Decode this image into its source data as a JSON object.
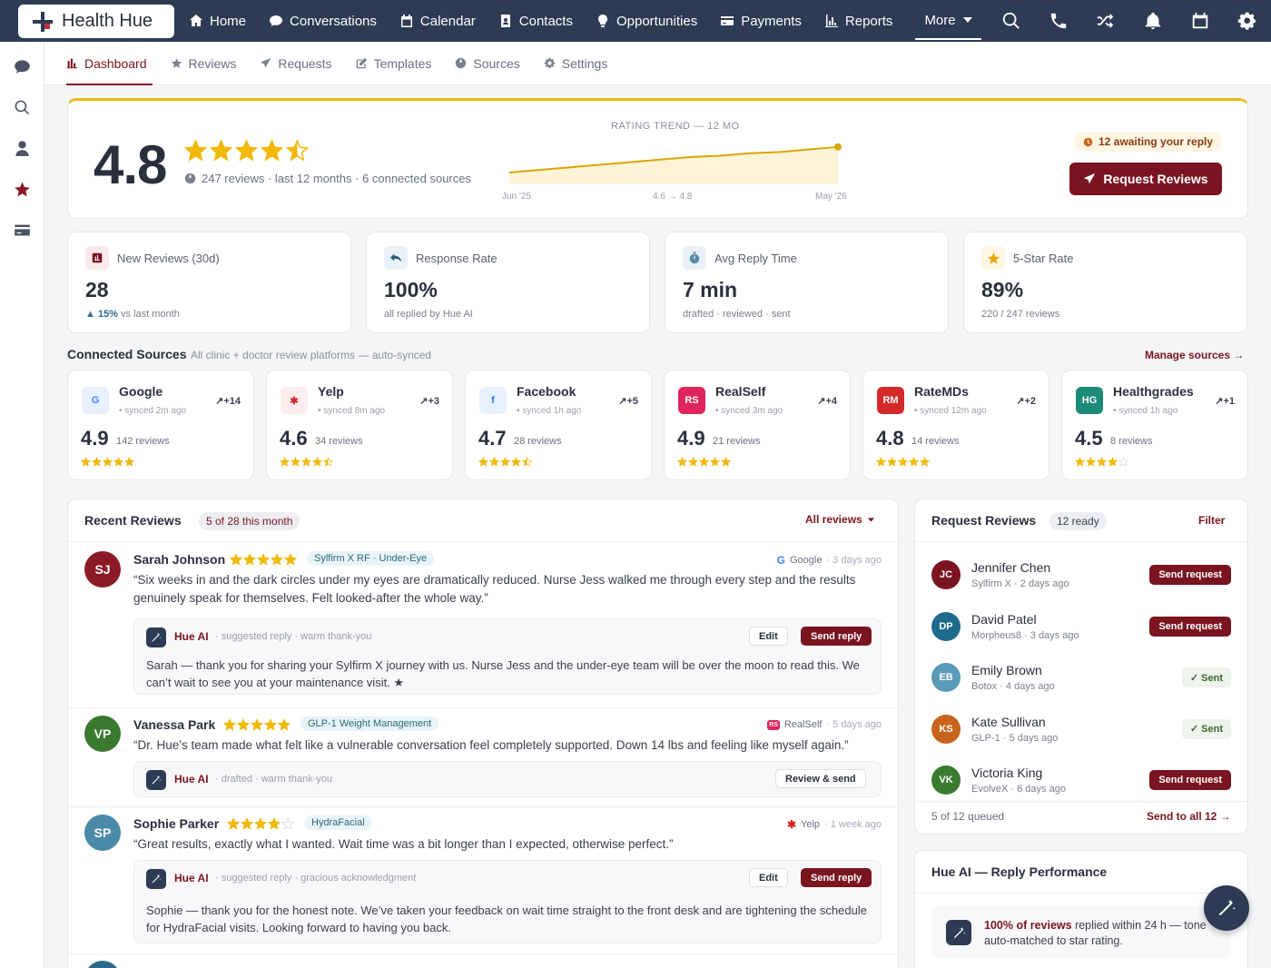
{
  "app": {
    "logo_text": "Health Hue"
  },
  "nav": {
    "items": [
      {
        "label": "Home",
        "icon": "home-icon"
      },
      {
        "label": "Conversations",
        "icon": "chat-icon"
      },
      {
        "label": "Calendar",
        "icon": "calendar-icon"
      },
      {
        "label": "Contacts",
        "icon": "contacts-icon"
      },
      {
        "label": "Opportunities",
        "icon": "lightbulb-icon"
      },
      {
        "label": "Payments",
        "icon": "card-icon"
      },
      {
        "label": "Reports",
        "icon": "chart-icon"
      }
    ],
    "more": "More"
  },
  "subnav": {
    "tabs": [
      {
        "label": "Dashboard",
        "active": true
      },
      {
        "label": "Reviews"
      },
      {
        "label": "Requests"
      },
      {
        "label": "Templates"
      },
      {
        "label": "Sources"
      },
      {
        "label": "Settings"
      }
    ]
  },
  "hero": {
    "rating": "4.8",
    "stars": 4.5,
    "subtitle": "247 reviews · last 12 months · 6 connected sources",
    "trend_title": "RATING TREND — 12 MO",
    "trend_start": "Jun '25",
    "trend_mid": "4.6 → 4.8",
    "trend_end": "May '26",
    "trend_values": [
      4.6,
      4.62,
      4.64,
      4.66,
      4.68,
      4.7,
      4.72,
      4.73,
      4.75,
      4.76,
      4.78,
      4.8
    ],
    "awaiting": "12 awaiting your reply",
    "request_button": "Request Reviews"
  },
  "stats": [
    {
      "label": "New Reviews (30d)",
      "value": "28",
      "sub_highlight": "▲ 15%",
      "sub": " vs last month"
    },
    {
      "label": "Response Rate",
      "value": "100%",
      "sub": "all replied by Hue AI"
    },
    {
      "label": "Avg Reply Time",
      "value": "7 min",
      "sub": "drafted · reviewed · sent"
    },
    {
      "label": "5-Star Rate",
      "value": "89%",
      "sub": "220 / 247 reviews"
    }
  ],
  "sources": {
    "title": "Connected Sources",
    "desc": "All clinic + doctor review platforms — auto-synced",
    "manage": "Manage sources →",
    "items": [
      {
        "name": "Google",
        "badge": "G",
        "color": "#e8f0fe",
        "badge_text": "#4285f4",
        "sync": "synced 2m ago",
        "delta": "+14",
        "rating": "4.9",
        "count": "142 reviews",
        "stars": 5
      },
      {
        "name": "Yelp",
        "badge": "✱",
        "color": "#fdecee",
        "badge_text": "#d32323",
        "sync": "synced 8m ago",
        "delta": "+3",
        "rating": "4.6",
        "count": "34 reviews",
        "stars": 4.5
      },
      {
        "name": "Facebook",
        "badge": "f",
        "color": "#e7f0fd",
        "badge_text": "#1877f2",
        "sync": "synced 1h ago",
        "delta": "+5",
        "rating": "4.7",
        "count": "28 reviews",
        "stars": 4.5
      },
      {
        "name": "RealSelf",
        "badge": "RS",
        "color": "#e0245e",
        "badge_text": "#ffffff",
        "sync": "synced 3m ago",
        "delta": "+4",
        "rating": "4.9",
        "count": "21 reviews",
        "stars": 5
      },
      {
        "name": "RateMDs",
        "badge": "RM",
        "color": "#d42a2a",
        "badge_text": "#ffffff",
        "sync": "synced 12m ago",
        "delta": "+2",
        "rating": "4.8",
        "count": "14 reviews",
        "stars": 5
      },
      {
        "name": "Healthgrades",
        "badge": "HG",
        "color": "#1d8a7a",
        "badge_text": "#ffffff",
        "sync": "synced 1h ago",
        "delta": "+1",
        "rating": "4.5",
        "count": "8 reviews",
        "stars": 4
      }
    ]
  },
  "recent": {
    "title": "Recent Reviews",
    "pill": "5 of 28 this month",
    "filter": "All reviews",
    "reviews": [
      {
        "initials": "SJ",
        "avatar_color": "#8b1a24",
        "name": "Sarah Johnson",
        "stars": 5,
        "tag": "Sylfirm X RF · Under-Eye",
        "source": "Google",
        "when": "· 3 days ago",
        "text": "“Six weeks in and the dark circles under my eyes are dramatically reduced. Nurse Jess walked me through every step and the results genuinely speak for themselves. Felt looked-after the whole way.”",
        "ai_label": "Hue AI",
        "ai_meta": "· suggested reply · warm thank-you",
        "edit": "Edit",
        "send": "Send reply",
        "reply": "Sarah — thank you for sharing your Sylfirm X journey with us. Nurse Jess and the under-eye team will be over the moon to read this. We can’t wait to see you at your maintenance visit. ★"
      },
      {
        "initials": "VP",
        "avatar_color": "#3a7a2e",
        "name": "Vanessa Park",
        "stars": 5,
        "tag": "GLP-1 Weight Management",
        "source": "RealSelf",
        "when": "· 5 days ago",
        "text": "“Dr. Hue’s team made what felt like a vulnerable conversation feel completely supported. Down 14 lbs and feeling like myself again.”",
        "ai_label": "Hue AI",
        "ai_meta": "· drafted · warm thank-you",
        "review_send": "Review & send"
      },
      {
        "initials": "SP",
        "avatar_color": "#4a8aa8",
        "name": "Sophie Parker",
        "stars": 4,
        "tag": "HydraFacial",
        "source": "Yelp",
        "when": "· 1 week ago",
        "text": "“Great results, exactly what I wanted. Wait time was a bit longer than I expected, otherwise perfect.”",
        "ai_label": "Hue AI",
        "ai_meta": "· suggested reply · gracious acknowledgment",
        "edit": "Edit",
        "send": "Send reply",
        "reply": "Sophie — thank you for the honest note. We’ve taken your feedback on wait time straight to the front desk and are tightening the schedule for HydraFacial visits. Looking forward to having you back."
      }
    ]
  },
  "requests": {
    "title": "Request Reviews",
    "pill": "12 ready",
    "filter": "Filter",
    "rows": [
      {
        "initials": "JC",
        "color": "#7a1420",
        "name": "Jennifer Chen",
        "sub": "Sylfirm X · 2 days ago",
        "action": "Send request",
        "sent": false
      },
      {
        "initials": "DP",
        "color": "#1d6a8a",
        "name": "David Patel",
        "sub": "Morpheus8 · 3 days ago",
        "action": "Send request",
        "sent": false
      },
      {
        "initials": "EB",
        "color": "#5a9ab8",
        "name": "Emily Brown",
        "sub": "Botox · 4 days ago",
        "action": "✓ Sent",
        "sent": true
      },
      {
        "initials": "KS",
        "color": "#c8641e",
        "name": "Kate Sullivan",
        "sub": "GLP-1 · 5 days ago",
        "action": "✓ Sent",
        "sent": true
      },
      {
        "initials": "VK",
        "color": "#3a7a2e",
        "name": "Victoria King",
        "sub": "EvolveX · 6 days ago",
        "action": "Send request",
        "sent": false
      }
    ],
    "footer": "5 of 12 queued",
    "send_all": "Send to all 12 →"
  },
  "performance": {
    "title": "Hue AI — Reply Performance",
    "highlight": "100% of reviews",
    "text": " replied within 24 h — tone auto-matched to star rating."
  },
  "colors": {
    "brand": "#7a1420",
    "nav": "#2d3b54",
    "star": "#f0b90b"
  }
}
